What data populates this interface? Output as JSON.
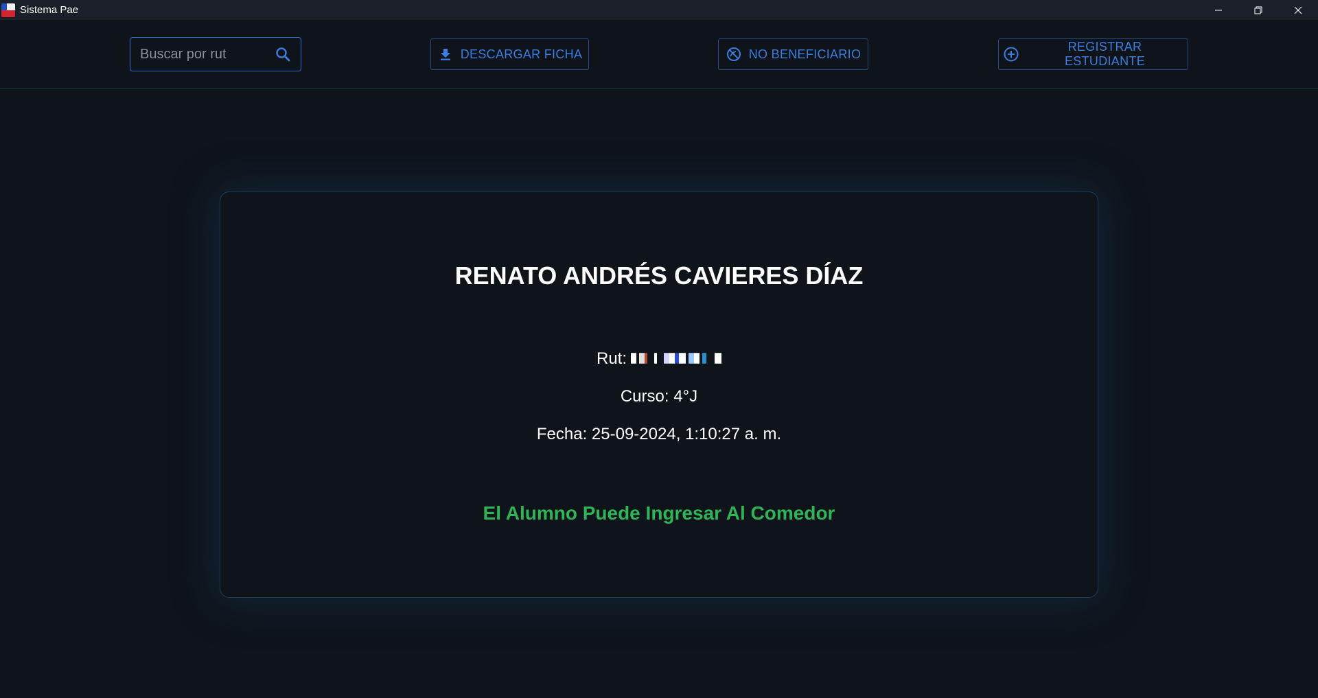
{
  "window": {
    "title": "Sistema Pae"
  },
  "toolbar": {
    "search_placeholder": "Buscar por rut",
    "search_value": "",
    "download_label": "DESCARGAR FICHA",
    "no_beneficiary_label": "NO BENEFICIARIO",
    "register_label": "REGISTRAR ESTUDIANTE"
  },
  "student": {
    "name": "RENATO ANDRÉS CAVIERES DÍAZ",
    "rut_label": "Rut:",
    "curso_label": "Curso:",
    "curso_value": "4°J",
    "fecha_label": "Fecha:",
    "fecha_value": "25-09-2024, 1:10:27 a. m.",
    "status_message": "El Alumno Puede Ingresar Al Comedor"
  },
  "colors": {
    "background": "#0f131a",
    "accent": "#3a7ee0",
    "status_ok": "#2fb457"
  },
  "icons": {
    "download": "download-icon",
    "no_beneficiary": "block-icon",
    "register": "add-circle-icon",
    "search": "search-icon"
  }
}
